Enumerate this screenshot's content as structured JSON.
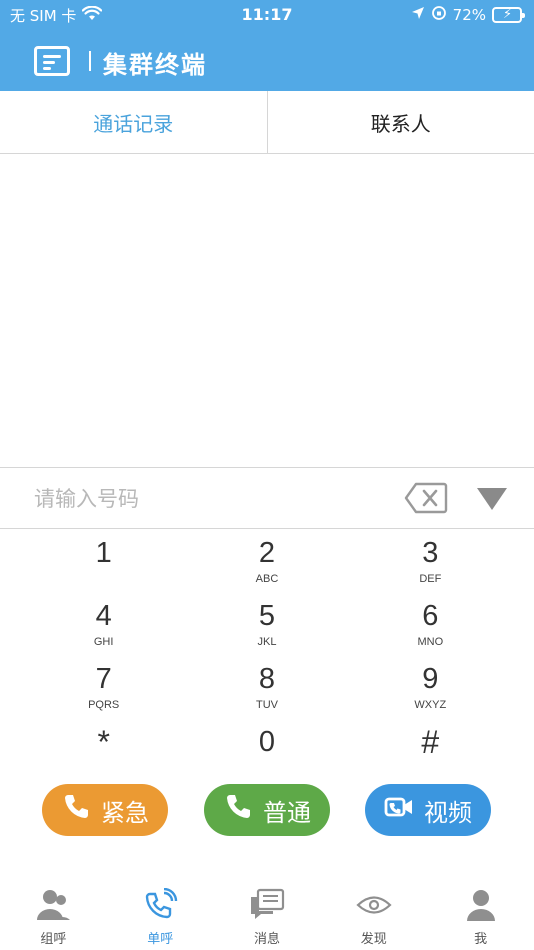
{
  "status": {
    "carrier": "无 SIM 卡",
    "time": "11:17",
    "battery": "72%"
  },
  "header": {
    "title": "集群终端"
  },
  "tabs": [
    {
      "label": "通话记录",
      "active": true
    },
    {
      "label": "联系人",
      "active": false
    }
  ],
  "dialer": {
    "placeholder": "请输入号码",
    "value": ""
  },
  "keypad": [
    {
      "digit": "1",
      "letters": ""
    },
    {
      "digit": "2",
      "letters": "ABC"
    },
    {
      "digit": "3",
      "letters": "DEF"
    },
    {
      "digit": "4",
      "letters": "GHI"
    },
    {
      "digit": "5",
      "letters": "JKL"
    },
    {
      "digit": "6",
      "letters": "MNO"
    },
    {
      "digit": "7",
      "letters": "PQRS"
    },
    {
      "digit": "8",
      "letters": "TUV"
    },
    {
      "digit": "9",
      "letters": "WXYZ"
    },
    {
      "digit": "*",
      "letters": ""
    },
    {
      "digit": "0",
      "letters": ""
    },
    {
      "digit": "#",
      "letters": ""
    }
  ],
  "call_buttons": {
    "emergency": "紧急",
    "normal": "普通",
    "video": "视频"
  },
  "bottom_nav": [
    {
      "label": "组呼",
      "icon": "group-call-icon",
      "active": false
    },
    {
      "label": "单呼",
      "icon": "single-call-icon",
      "active": true
    },
    {
      "label": "消息",
      "icon": "message-icon",
      "active": false
    },
    {
      "label": "发现",
      "icon": "discover-eye-icon",
      "active": false
    },
    {
      "label": "我",
      "icon": "profile-icon",
      "active": false
    }
  ],
  "colors": {
    "primary": "#52a9e6",
    "emergency": "#eb9a33",
    "normal": "#5ea948",
    "video": "#3b96df"
  }
}
